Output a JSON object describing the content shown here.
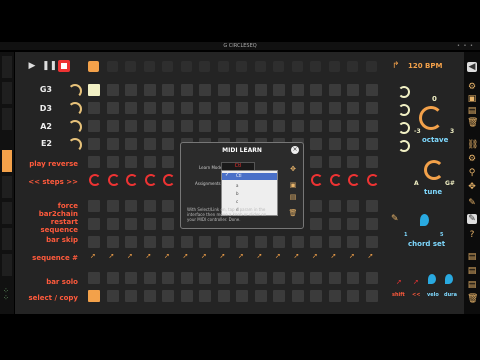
{
  "window": {
    "title": "G CIRCLESEQ",
    "dots": "• • •"
  },
  "transport": {
    "play": "▶",
    "pause": "❚❚"
  },
  "tempo": {
    "bpm_label": "120 BPM"
  },
  "tracks": {
    "notes": [
      "G3",
      "D3",
      "A2",
      "E2"
    ],
    "labels": [
      "play reverse",
      "<< steps >>",
      "force bar2chain",
      "restart sequence",
      "bar skip",
      "sequence #",
      "bar solo",
      "select / copy"
    ]
  },
  "dialog": {
    "title": "MIDI LEARN",
    "learn_mode_label": "Learn Mode",
    "assignment_label": "Assignments",
    "selected_value": "Ctl",
    "options": [
      "Ctl",
      "a",
      "b",
      "c",
      "d"
    ],
    "help_text": "With Select/Link on, tap a param in the interface then move a knob or slider on your MIDI controller. Done.",
    "close": "×"
  },
  "right_panel": {
    "octave_label": "octave",
    "octave_min": "-3",
    "octave_max": "3",
    "octave_value": "0",
    "tune_label": "tune",
    "tune_min": "A",
    "tune_max": "G#",
    "chord_label": "chord set",
    "chord_num_1": "1",
    "chord_num_2": "5",
    "bottom_labels": [
      "shift",
      "<<",
      "velo",
      "dura"
    ]
  },
  "colors": {
    "accent": "#f3a14a",
    "label_red": "#ff5a3c",
    "stop": "#e33333"
  }
}
